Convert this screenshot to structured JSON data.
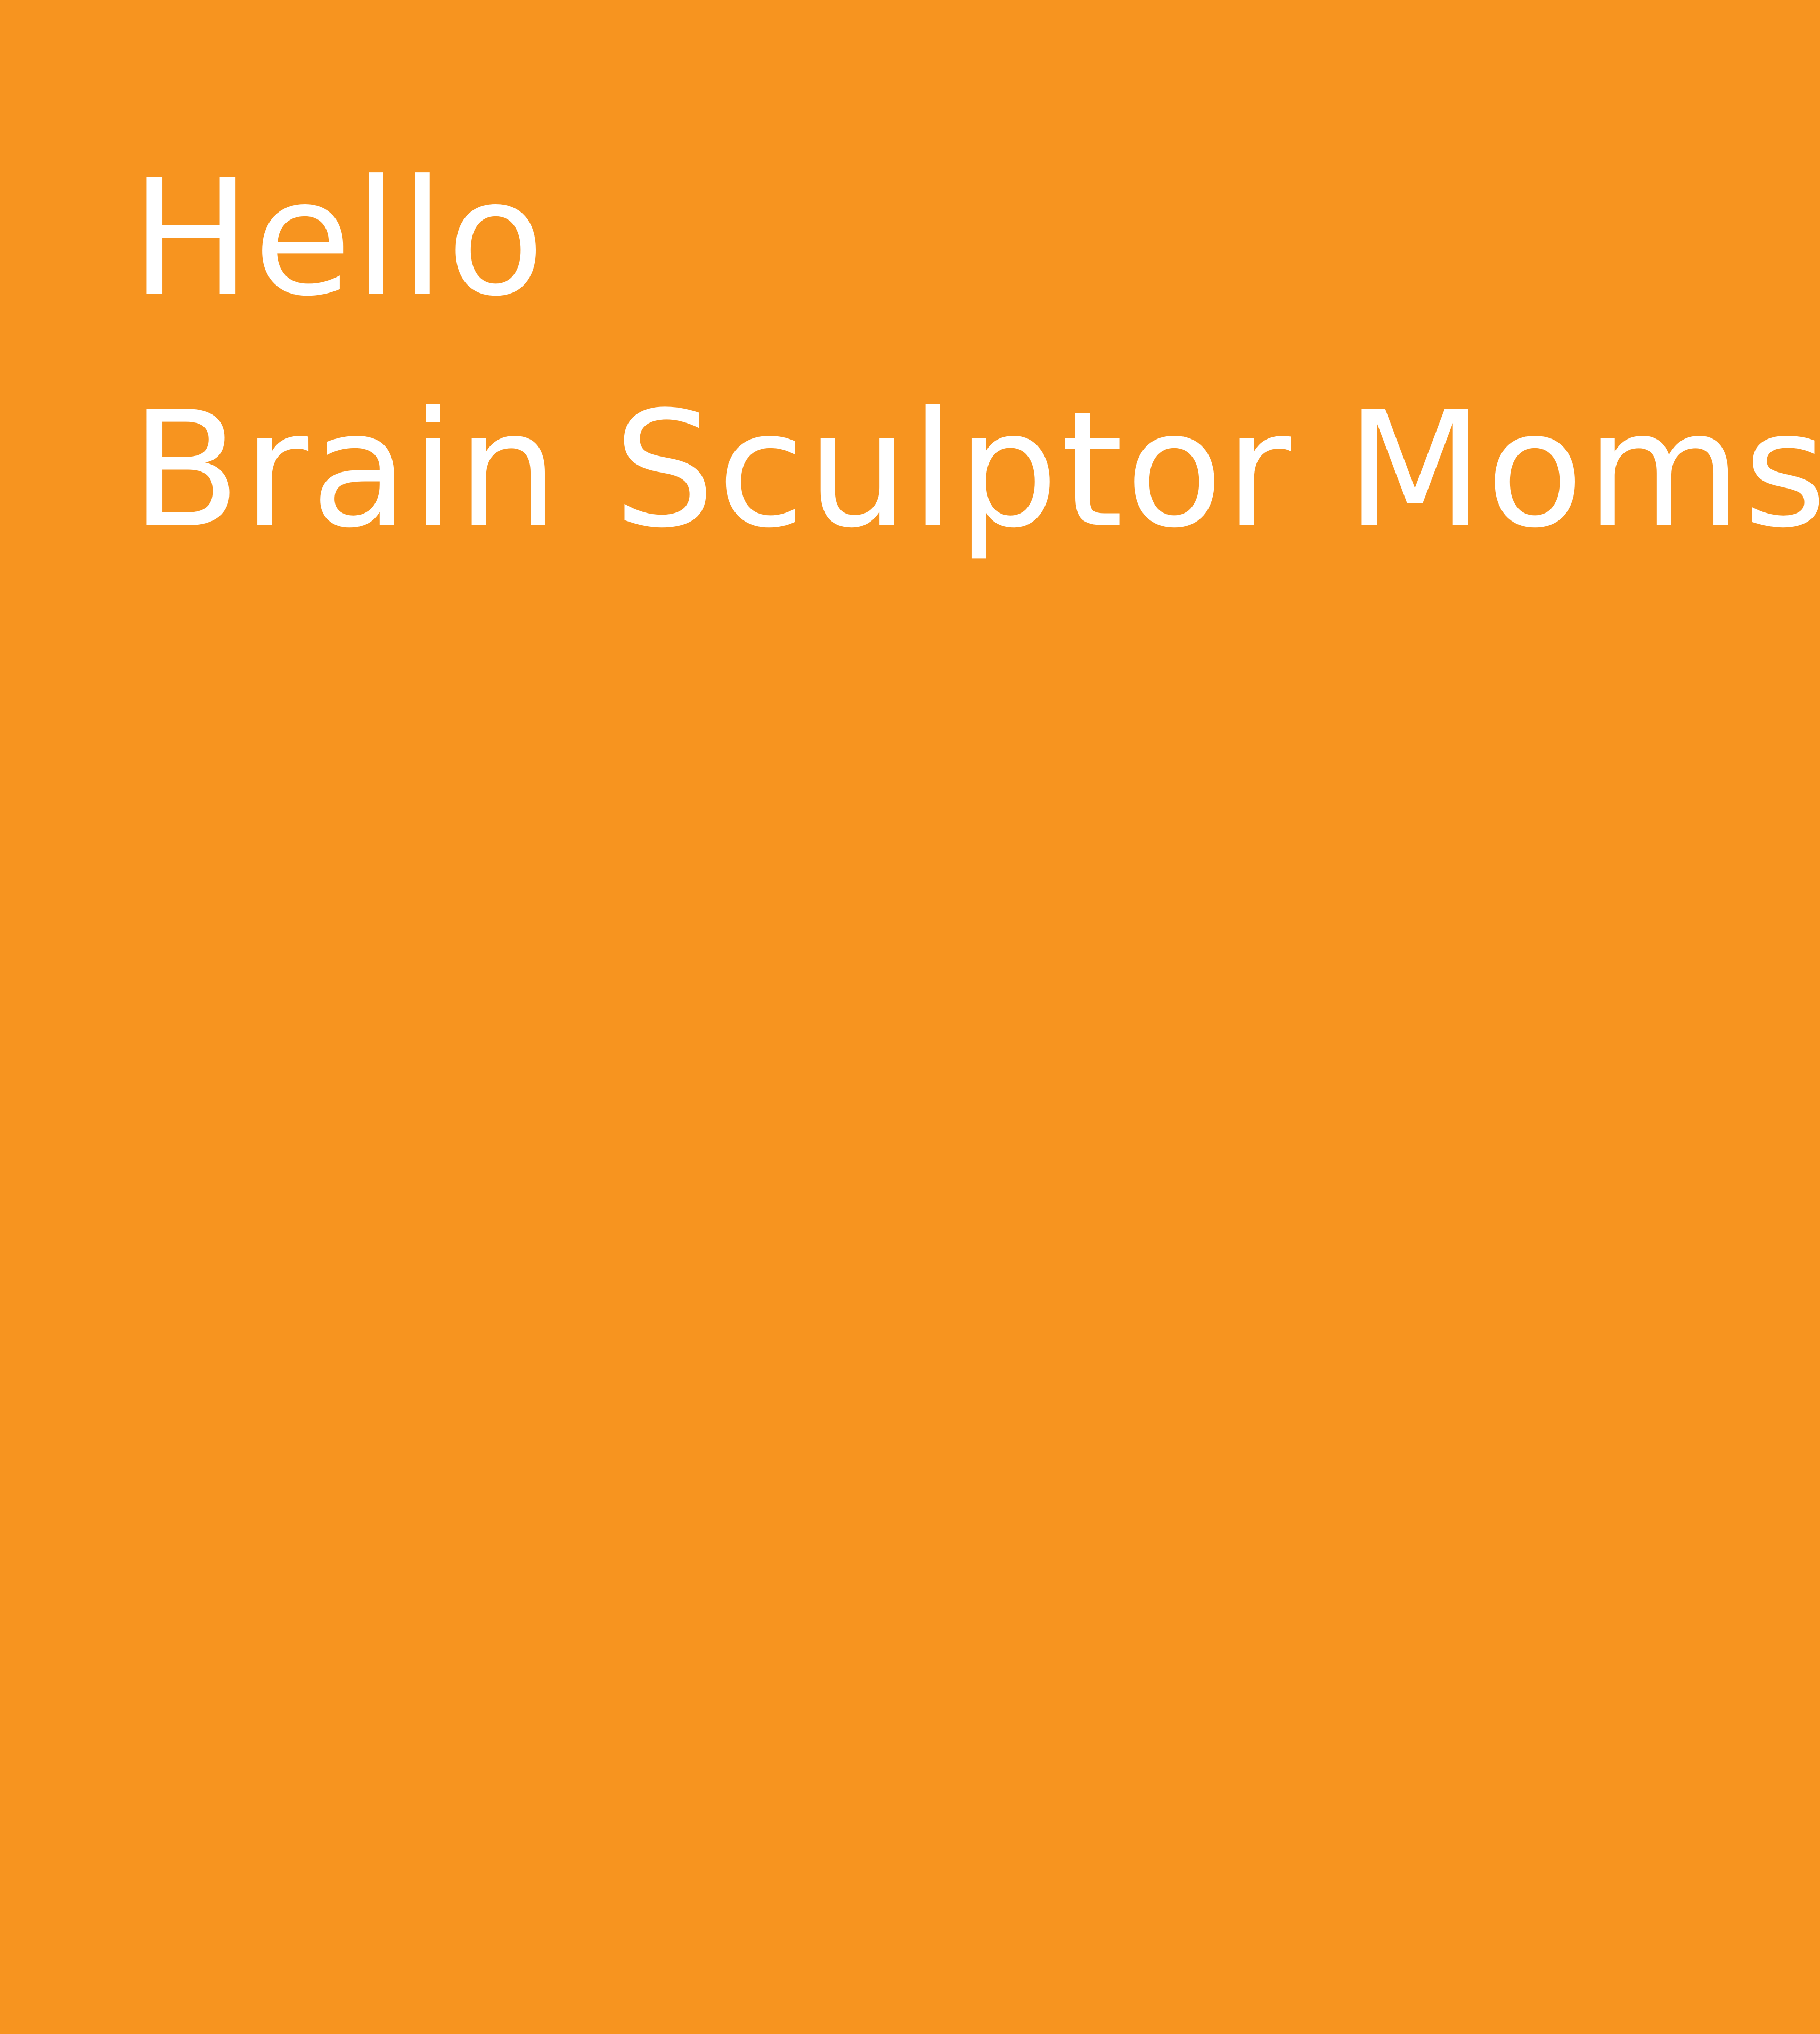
{
  "background_color": "#f7941f",
  "text_color": "#ffffff",
  "greeting": {
    "line1": "Hello",
    "line2": "Brain Sculptor Moms!"
  }
}
